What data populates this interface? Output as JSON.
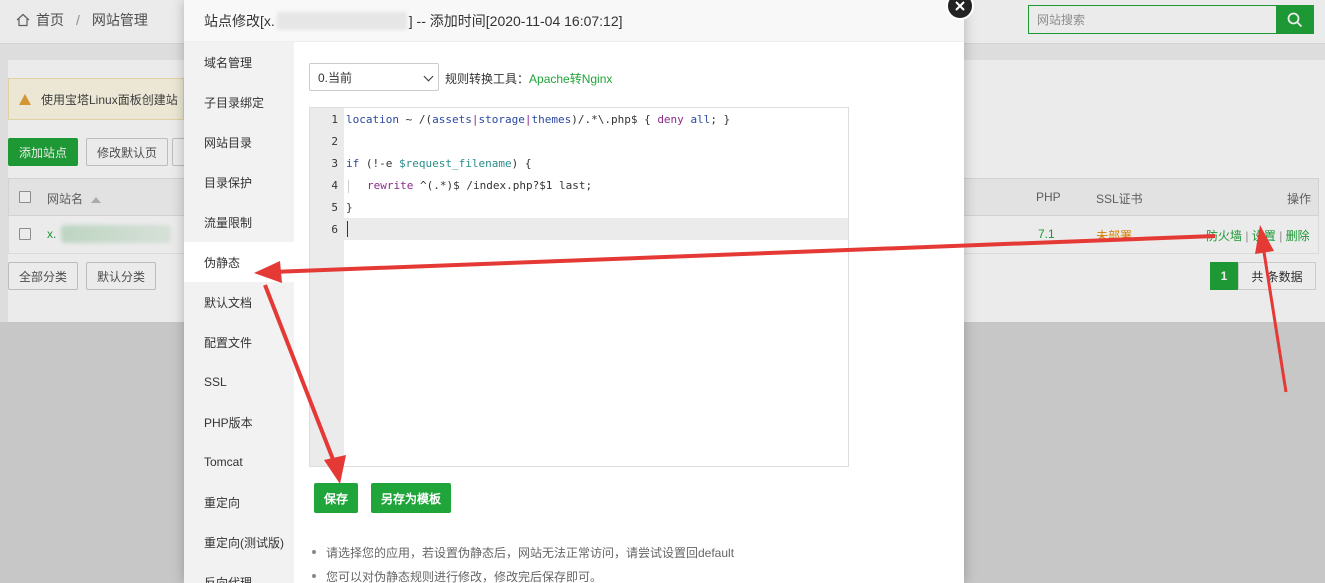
{
  "header": {
    "home_label": "首页",
    "separator": "/",
    "page_label": "网站管理",
    "search_placeholder": "网站搜索"
  },
  "notice": {
    "text": "使用宝塔Linux面板创建站"
  },
  "toolbar": {
    "add_site": "添加站点",
    "default_page": "修改默认页"
  },
  "table": {
    "headers": {
      "name": "网站名",
      "php": "PHP",
      "ssl": "SSL证书",
      "actions": "操作"
    },
    "rows": [
      {
        "name_prefix": "x.",
        "php": "7.1",
        "ssl": "未部署",
        "firewall": "防火墙",
        "settings": "设置",
        "delete": "删除",
        "sep": "|"
      }
    ]
  },
  "categories": {
    "all": "全部分类",
    "default": "默认分类"
  },
  "pager": {
    "current": "1",
    "summary": "共  条数据"
  },
  "modal": {
    "title_prefix": "站点修改[x.",
    "title_suffix": "] -- 添加时间[2020-11-04 16:07:12]",
    "nav": [
      "域名管理",
      "子目录绑定",
      "网站目录",
      "目录保护",
      "流量限制",
      "伪静态",
      "默认文档",
      "配置文件",
      "SSL",
      "PHP版本",
      "Tomcat",
      "重定向",
      "重定向(测试版)",
      "反向代理"
    ],
    "active_nav_index": 5,
    "select_value": "0.当前",
    "tool_label": "规则转换工具：",
    "tool_link": "Apache转Nginx",
    "line_numbers": [
      "1",
      "2",
      "3",
      "4",
      "5",
      "6"
    ],
    "code": {
      "l1_a": "location",
      "l1_b": " ~ /(",
      "l1_c": "assets",
      "l1_d": "|",
      "l1_e": "storage",
      "l1_f": "|",
      "l1_g": "themes",
      "l1_h": ")/.*\\.php$ { ",
      "l1_i": "deny",
      "l1_j": " ",
      "l1_k": "all",
      "l1_l": "; }",
      "l3_a": "if",
      "l3_b": " (!-e ",
      "l3_c": "$request_filename",
      "l3_d": ") {",
      "l4_a": "rewrite",
      "l4_b": " ^(.*)$ /index.php?$1 last;",
      "l5": "}"
    },
    "save_button": "保存",
    "save_template_button": "另存为模板",
    "tips": [
      "请选择您的应用，若设置伪静态后，网站无法正常访问，请尝试设置回default",
      "您可以对伪静态规则进行修改，修改完后保存即可。"
    ]
  },
  "colors": {
    "accent": "#20a53a",
    "warning": "#e68a00",
    "annotation": "#e53935"
  }
}
